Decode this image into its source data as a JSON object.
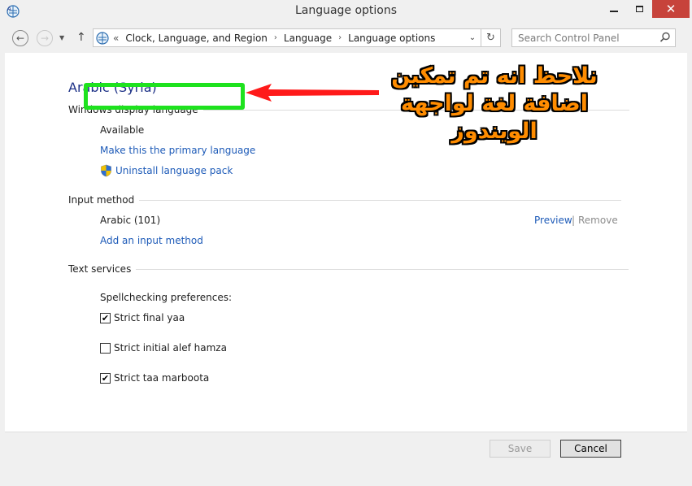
{
  "window": {
    "title": "Language options",
    "close_glyph": "✕"
  },
  "nav": {
    "back_glyph": "←",
    "forward_glyph": "→",
    "recent_glyph": "▼",
    "up_glyph": "↑",
    "breadcrumb_prefix": "«",
    "breadcrumbs": [
      "Clock, Language, and Region",
      "Language",
      "Language options"
    ],
    "separator": "›",
    "dropdown_glyph": "⌄",
    "refresh_glyph": "↻",
    "search_placeholder": "Search Control Panel"
  },
  "main": {
    "heading": "Arabic (Syria)",
    "display_language": {
      "label": "Windows display language",
      "status": "Available",
      "primary_link": "Make this the primary language",
      "uninstall_link": "Uninstall language pack"
    },
    "input_method": {
      "label": "Input method",
      "method": "Arabic (101)",
      "preview": "Preview",
      "pipe": "|",
      "remove": "Remove",
      "add_link": "Add an input method"
    },
    "text_services": {
      "label": "Text services",
      "spell_label": "Spellchecking preferences:",
      "checks": [
        {
          "label": "Strict final yaa",
          "checked": true
        },
        {
          "label": "Strict initial alef hamza",
          "checked": false
        },
        {
          "label": "Strict taa marboota",
          "checked": true
        }
      ]
    }
  },
  "annotation": {
    "line1": "نلاحظ انه تم تمكين",
    "line2": "اضافة لغة لواجهة الويندوز",
    "highlight_color": "#1ee21e",
    "arrow_color": "#ff1a1a",
    "text_color": "#ff8c00"
  },
  "footer": {
    "save": "Save",
    "cancel": "Cancel"
  },
  "colors": {
    "link": "#1e5bb8",
    "heading": "#1e3287",
    "close_button": "#c7433b"
  }
}
